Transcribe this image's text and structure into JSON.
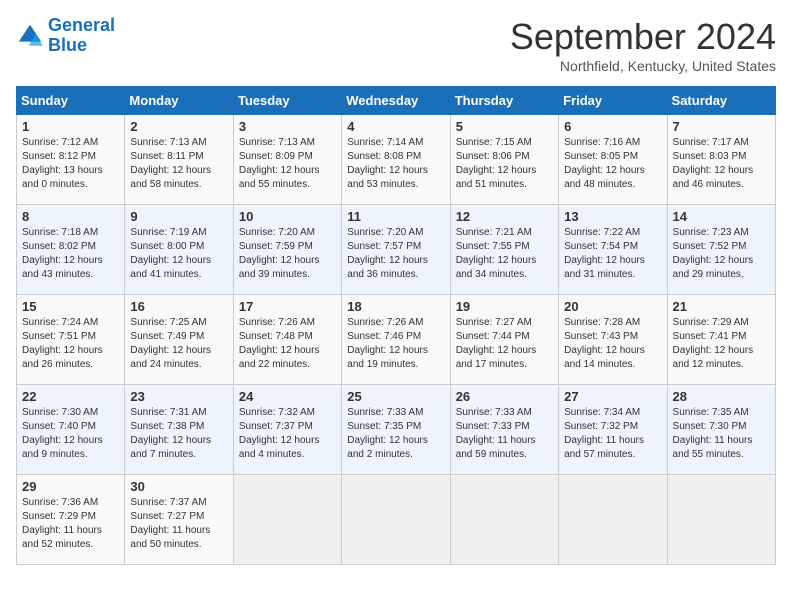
{
  "logo": {
    "line1": "General",
    "line2": "Blue"
  },
  "title": "September 2024",
  "subtitle": "Northfield, Kentucky, United States",
  "weekdays": [
    "Sunday",
    "Monday",
    "Tuesday",
    "Wednesday",
    "Thursday",
    "Friday",
    "Saturday"
  ],
  "weeks": [
    [
      {
        "day": "1",
        "info": "Sunrise: 7:12 AM\nSunset: 8:12 PM\nDaylight: 13 hours\nand 0 minutes."
      },
      {
        "day": "2",
        "info": "Sunrise: 7:13 AM\nSunset: 8:11 PM\nDaylight: 12 hours\nand 58 minutes."
      },
      {
        "day": "3",
        "info": "Sunrise: 7:13 AM\nSunset: 8:09 PM\nDaylight: 12 hours\nand 55 minutes."
      },
      {
        "day": "4",
        "info": "Sunrise: 7:14 AM\nSunset: 8:08 PM\nDaylight: 12 hours\nand 53 minutes."
      },
      {
        "day": "5",
        "info": "Sunrise: 7:15 AM\nSunset: 8:06 PM\nDaylight: 12 hours\nand 51 minutes."
      },
      {
        "day": "6",
        "info": "Sunrise: 7:16 AM\nSunset: 8:05 PM\nDaylight: 12 hours\nand 48 minutes."
      },
      {
        "day": "7",
        "info": "Sunrise: 7:17 AM\nSunset: 8:03 PM\nDaylight: 12 hours\nand 46 minutes."
      }
    ],
    [
      {
        "day": "8",
        "info": "Sunrise: 7:18 AM\nSunset: 8:02 PM\nDaylight: 12 hours\nand 43 minutes."
      },
      {
        "day": "9",
        "info": "Sunrise: 7:19 AM\nSunset: 8:00 PM\nDaylight: 12 hours\nand 41 minutes."
      },
      {
        "day": "10",
        "info": "Sunrise: 7:20 AM\nSunset: 7:59 PM\nDaylight: 12 hours\nand 39 minutes."
      },
      {
        "day": "11",
        "info": "Sunrise: 7:20 AM\nSunset: 7:57 PM\nDaylight: 12 hours\nand 36 minutes."
      },
      {
        "day": "12",
        "info": "Sunrise: 7:21 AM\nSunset: 7:55 PM\nDaylight: 12 hours\nand 34 minutes."
      },
      {
        "day": "13",
        "info": "Sunrise: 7:22 AM\nSunset: 7:54 PM\nDaylight: 12 hours\nand 31 minutes."
      },
      {
        "day": "14",
        "info": "Sunrise: 7:23 AM\nSunset: 7:52 PM\nDaylight: 12 hours\nand 29 minutes."
      }
    ],
    [
      {
        "day": "15",
        "info": "Sunrise: 7:24 AM\nSunset: 7:51 PM\nDaylight: 12 hours\nand 26 minutes."
      },
      {
        "day": "16",
        "info": "Sunrise: 7:25 AM\nSunset: 7:49 PM\nDaylight: 12 hours\nand 24 minutes."
      },
      {
        "day": "17",
        "info": "Sunrise: 7:26 AM\nSunset: 7:48 PM\nDaylight: 12 hours\nand 22 minutes."
      },
      {
        "day": "18",
        "info": "Sunrise: 7:26 AM\nSunset: 7:46 PM\nDaylight: 12 hours\nand 19 minutes."
      },
      {
        "day": "19",
        "info": "Sunrise: 7:27 AM\nSunset: 7:44 PM\nDaylight: 12 hours\nand 17 minutes."
      },
      {
        "day": "20",
        "info": "Sunrise: 7:28 AM\nSunset: 7:43 PM\nDaylight: 12 hours\nand 14 minutes."
      },
      {
        "day": "21",
        "info": "Sunrise: 7:29 AM\nSunset: 7:41 PM\nDaylight: 12 hours\nand 12 minutes."
      }
    ],
    [
      {
        "day": "22",
        "info": "Sunrise: 7:30 AM\nSunset: 7:40 PM\nDaylight: 12 hours\nand 9 minutes."
      },
      {
        "day": "23",
        "info": "Sunrise: 7:31 AM\nSunset: 7:38 PM\nDaylight: 12 hours\nand 7 minutes."
      },
      {
        "day": "24",
        "info": "Sunrise: 7:32 AM\nSunset: 7:37 PM\nDaylight: 12 hours\nand 4 minutes."
      },
      {
        "day": "25",
        "info": "Sunrise: 7:33 AM\nSunset: 7:35 PM\nDaylight: 12 hours\nand 2 minutes."
      },
      {
        "day": "26",
        "info": "Sunrise: 7:33 AM\nSunset: 7:33 PM\nDaylight: 11 hours\nand 59 minutes."
      },
      {
        "day": "27",
        "info": "Sunrise: 7:34 AM\nSunset: 7:32 PM\nDaylight: 11 hours\nand 57 minutes."
      },
      {
        "day": "28",
        "info": "Sunrise: 7:35 AM\nSunset: 7:30 PM\nDaylight: 11 hours\nand 55 minutes."
      }
    ],
    [
      {
        "day": "29",
        "info": "Sunrise: 7:36 AM\nSunset: 7:29 PM\nDaylight: 11 hours\nand 52 minutes."
      },
      {
        "day": "30",
        "info": "Sunrise: 7:37 AM\nSunset: 7:27 PM\nDaylight: 11 hours\nand 50 minutes."
      },
      {
        "day": "",
        "info": ""
      },
      {
        "day": "",
        "info": ""
      },
      {
        "day": "",
        "info": ""
      },
      {
        "day": "",
        "info": ""
      },
      {
        "day": "",
        "info": ""
      }
    ]
  ]
}
